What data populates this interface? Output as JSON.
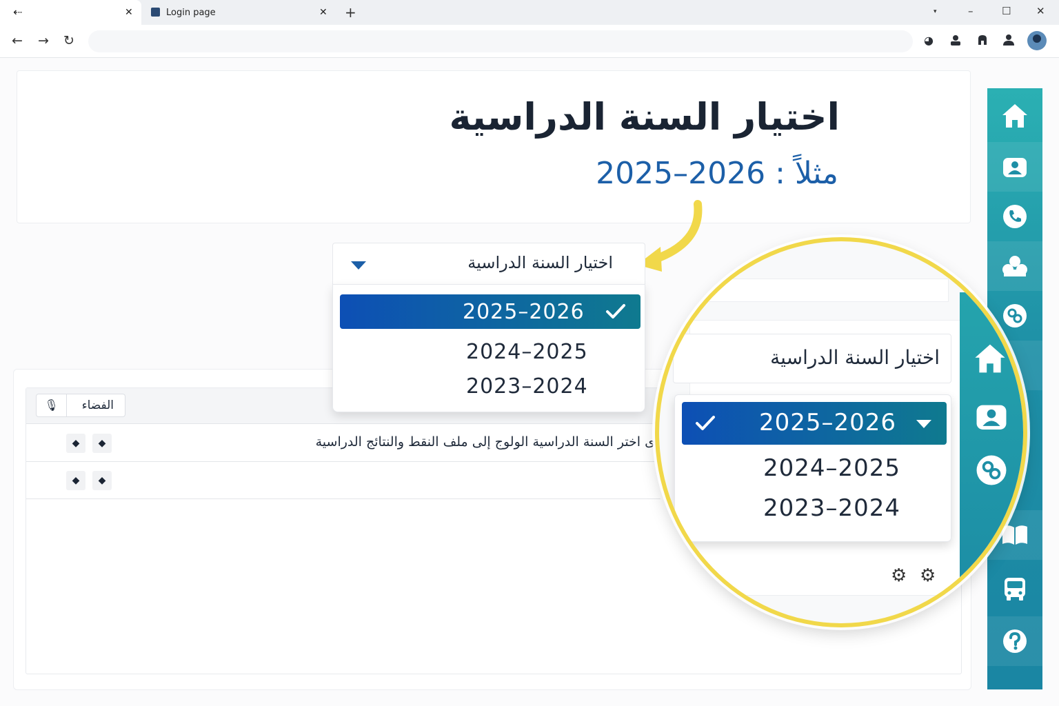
{
  "browser": {
    "tabs": [
      {
        "label": "",
        "active": true
      },
      {
        "label": "Login page",
        "active": false
      }
    ],
    "new_tab": "+",
    "controls": {
      "minimize": "–",
      "maximize": "☐",
      "close": "✕"
    },
    "icons": [
      "back-arrow-icon",
      "forward-arrow-icon",
      "reload-icon",
      "extension-icon",
      "person-icon",
      "puzzle-icon",
      "profile-icon"
    ]
  },
  "header": {
    "title": "اختيار السنة الدراسية",
    "example": "مثلاً : 2026–2025"
  },
  "year_select": {
    "label": "اختيار السنة الدراسية",
    "options": [
      "2025–2026",
      "2024–2025",
      "2023–2024"
    ],
    "selected": "2025–2026"
  },
  "table": {
    "space_button": "الفضاء",
    "rows": [
      {
        "text": "ى اختر السنة الدراسية الولوج إلى ملف النقط والنتائج الدراسية"
      },
      {
        "text": ""
      }
    ]
  },
  "sidebar": {
    "items": [
      "home-icon",
      "users-icon",
      "phone-icon",
      "group-icon",
      "link-icon",
      "book-icon",
      "bus-icon",
      "help-icon"
    ]
  },
  "colors": {
    "accent": "#1c5fa8",
    "sidebar": "#1e8fa6",
    "highlight": "#f1d84a",
    "selected_from": "#0d4fb5",
    "selected_to": "#0f7a8f"
  }
}
